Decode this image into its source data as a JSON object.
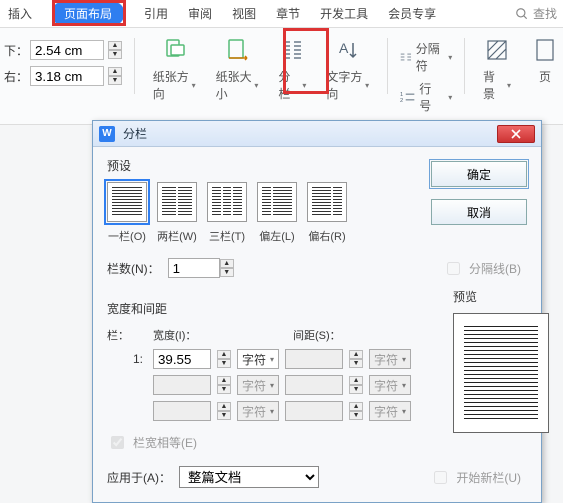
{
  "ribbon": {
    "tabs": [
      "插入",
      "页面布局",
      "引用",
      "审阅",
      "视图",
      "章节",
      "开发工具",
      "会员专享"
    ],
    "active": "页面布局",
    "search": "查找",
    "margin_top_label": "下：",
    "margin_top_value": "2.54 cm",
    "margin_right_label": "右：",
    "margin_right_value": "3.18 cm",
    "orientation": "纸张方向",
    "size": "纸张大小",
    "columns": "分栏",
    "textdir": "文字方向",
    "breaks": "分隔符",
    "linenum": "行号",
    "background": "背景",
    "page": "页"
  },
  "dialog": {
    "title": "分栏",
    "preset_label": "预设",
    "presets": [
      "一栏(O)",
      "两栏(W)",
      "三栏(T)",
      "偏左(L)",
      "偏右(R)"
    ],
    "ok": "确定",
    "cancel": "取消",
    "cols_label": "栏数(N)：",
    "cols_value": "1",
    "sep_label": "分隔线(B)",
    "ws_label": "宽度和间距",
    "col_head": "栏：",
    "width_head": "宽度(I)：",
    "spacing_head": "间距(S)：",
    "row1_idx": "1:",
    "row1_width": "39.55",
    "unit": "字符",
    "equal_label": "栏宽相等(E)",
    "preview_label": "预览",
    "apply_label": "应用于(A)：",
    "apply_value": "整篇文档",
    "newcol_label": "开始新栏(U)"
  }
}
